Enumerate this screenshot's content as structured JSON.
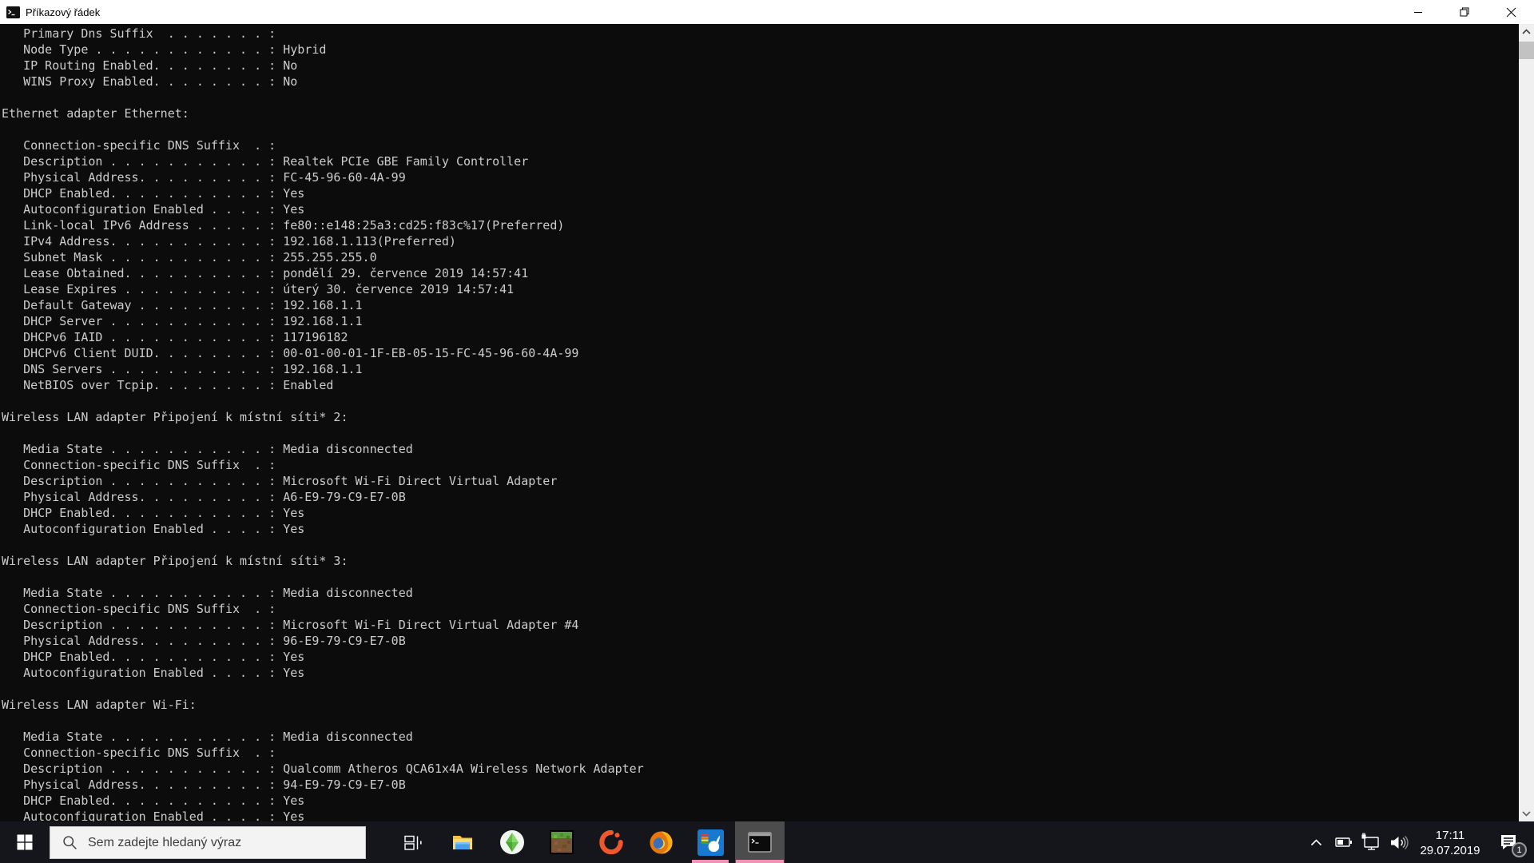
{
  "window": {
    "title": "Příkazový řádek"
  },
  "terminal": {
    "lines": [
      "   Primary Dns Suffix  . . . . . . . :",
      "   Node Type . . . . . . . . . . . . : Hybrid",
      "   IP Routing Enabled. . . . . . . . : No",
      "   WINS Proxy Enabled. . . . . . . . : No",
      "",
      "Ethernet adapter Ethernet:",
      "",
      "   Connection-specific DNS Suffix  . :",
      "   Description . . . . . . . . . . . : Realtek PCIe GBE Family Controller",
      "   Physical Address. . . . . . . . . : FC-45-96-60-4A-99",
      "   DHCP Enabled. . . . . . . . . . . : Yes",
      "   Autoconfiguration Enabled . . . . : Yes",
      "   Link-local IPv6 Address . . . . . : fe80::e148:25a3:cd25:f83c%17(Preferred)",
      "   IPv4 Address. . . . . . . . . . . : 192.168.1.113(Preferred)",
      "   Subnet Mask . . . . . . . . . . . : 255.255.255.0",
      "   Lease Obtained. . . . . . . . . . : pondělí 29. července 2019 14:57:41",
      "   Lease Expires . . . . . . . . . . : úterý 30. července 2019 14:57:41",
      "   Default Gateway . . . . . . . . . : 192.168.1.1",
      "   DHCP Server . . . . . . . . . . . : 192.168.1.1",
      "   DHCPv6 IAID . . . . . . . . . . . : 117196182",
      "   DHCPv6 Client DUID. . . . . . . . : 00-01-00-01-1F-EB-05-15-FC-45-96-60-4A-99",
      "   DNS Servers . . . . . . . . . . . : 192.168.1.1",
      "   NetBIOS over Tcpip. . . . . . . . : Enabled",
      "",
      "Wireless LAN adapter Připojení k místní síti* 2:",
      "",
      "   Media State . . . . . . . . . . . : Media disconnected",
      "   Connection-specific DNS Suffix  . :",
      "   Description . . . . . . . . . . . : Microsoft Wi-Fi Direct Virtual Adapter",
      "   Physical Address. . . . . . . . . : A6-E9-79-C9-E7-0B",
      "   DHCP Enabled. . . . . . . . . . . : Yes",
      "   Autoconfiguration Enabled . . . . : Yes",
      "",
      "Wireless LAN adapter Připojení k místní síti* 3:",
      "",
      "   Media State . . . . . . . . . . . : Media disconnected",
      "   Connection-specific DNS Suffix  . :",
      "   Description . . . . . . . . . . . : Microsoft Wi-Fi Direct Virtual Adapter #4",
      "   Physical Address. . . . . . . . . : 96-E9-79-C9-E7-0B",
      "   DHCP Enabled. . . . . . . . . . . : Yes",
      "   Autoconfiguration Enabled . . . . : Yes",
      "",
      "Wireless LAN adapter Wi-Fi:",
      "",
      "   Media State . . . . . . . . . . . : Media disconnected",
      "   Connection-specific DNS Suffix  . :",
      "   Description . . . . . . . . . . . : Qualcomm Atheros QCA61x4A Wireless Network Adapter",
      "   Physical Address. . . . . . . . . : 94-E9-79-C9-E7-0B",
      "   DHCP Enabled. . . . . . . . . . . : Yes",
      "   Autoconfiguration Enabled . . . . : Yes"
    ]
  },
  "taskbar": {
    "search_placeholder": "Sem zadejte hledaný výraz",
    "apps": [
      {
        "name": "task-view",
        "state": "idle"
      },
      {
        "name": "file-explorer",
        "state": "idle"
      },
      {
        "name": "sims",
        "state": "idle"
      },
      {
        "name": "minecraft",
        "state": "idle"
      },
      {
        "name": "origin",
        "state": "idle"
      },
      {
        "name": "firefox",
        "state": "idle"
      },
      {
        "name": "picpick",
        "state": "running"
      },
      {
        "name": "command-prompt",
        "state": "active"
      }
    ],
    "tray": {
      "time": "17:11",
      "date": "29.07.2019",
      "notification_count": "1"
    }
  },
  "icons": {
    "titlebar": [
      "cmd-icon",
      "minimize-icon",
      "restore-icon",
      "close-icon"
    ],
    "scrollbar": [
      "chevron-up-icon",
      "chevron-down-icon"
    ],
    "taskbar": [
      "windows-start-icon",
      "search-icon",
      "task-view-icon",
      "file-explorer-icon",
      "sims-icon",
      "minecraft-icon",
      "origin-icon",
      "firefox-icon",
      "picpick-icon",
      "cmd-window-icon"
    ],
    "tray": [
      "chevron-up-icon",
      "battery-icon",
      "ethernet-icon",
      "volume-icon",
      "action-center-icon"
    ]
  },
  "colors": {
    "terminal_bg": "#0c0c0c",
    "terminal_text": "#cccccc",
    "titlebar_bg": "#ffffff",
    "taskbar_bg": "#15151c",
    "accent_underline": "#ef92b4",
    "scrollbar_track": "#f0f0f0",
    "scrollbar_thumb": "#c2c2c2"
  }
}
